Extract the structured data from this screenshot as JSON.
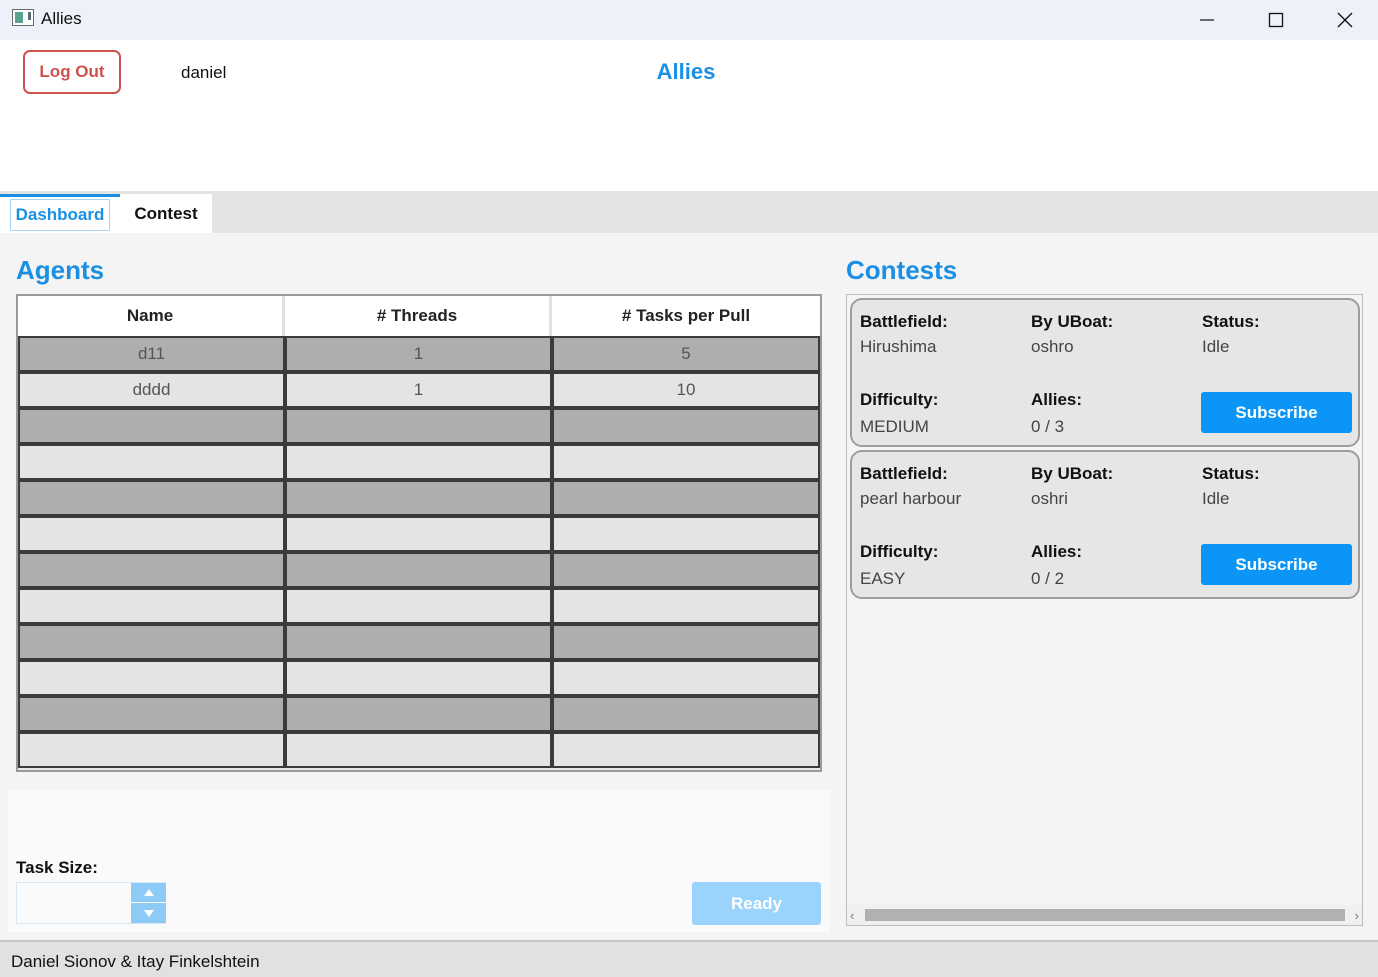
{
  "window": {
    "title": "Allies"
  },
  "header": {
    "logout_label": "Log Out",
    "username": "daniel",
    "app_heading": "Allies"
  },
  "tabs": [
    {
      "label": "Dashboard"
    },
    {
      "label": "Contest"
    }
  ],
  "agents": {
    "title": "Agents",
    "columns": [
      "Name",
      "# Threads",
      "# Tasks per Pull"
    ],
    "rows": [
      {
        "name": "d11",
        "threads": "1",
        "tasks": "5"
      },
      {
        "name": "dddd",
        "threads": "1",
        "tasks": "10"
      }
    ]
  },
  "task": {
    "label": "Task Size:",
    "value": "",
    "ready_label": "Ready"
  },
  "contests": {
    "title": "Contests",
    "labels": {
      "battlefield": "Battlefield:",
      "uboat": "By UBoat:",
      "status": "Status:",
      "difficulty": "Difficulty:",
      "allies": "Allies:"
    },
    "subscribe_label": "Subscribe",
    "items": [
      {
        "battlefield": "Hirushima",
        "uboat": "oshro",
        "status": "Idle",
        "difficulty": "MEDIUM",
        "allies": "0 / 3"
      },
      {
        "battlefield": "pearl harbour",
        "uboat": "oshri",
        "status": "Idle",
        "difficulty": "EASY",
        "allies": "0 / 2"
      }
    ]
  },
  "footer": {
    "credits": "Daniel Sionov & Itay Finkelshtein"
  },
  "colors": {
    "accent": "#1a8fe3",
    "logout": "#d0524f",
    "subscribe": "#0a95f7",
    "ready_disabled": "#9ad3fb"
  }
}
